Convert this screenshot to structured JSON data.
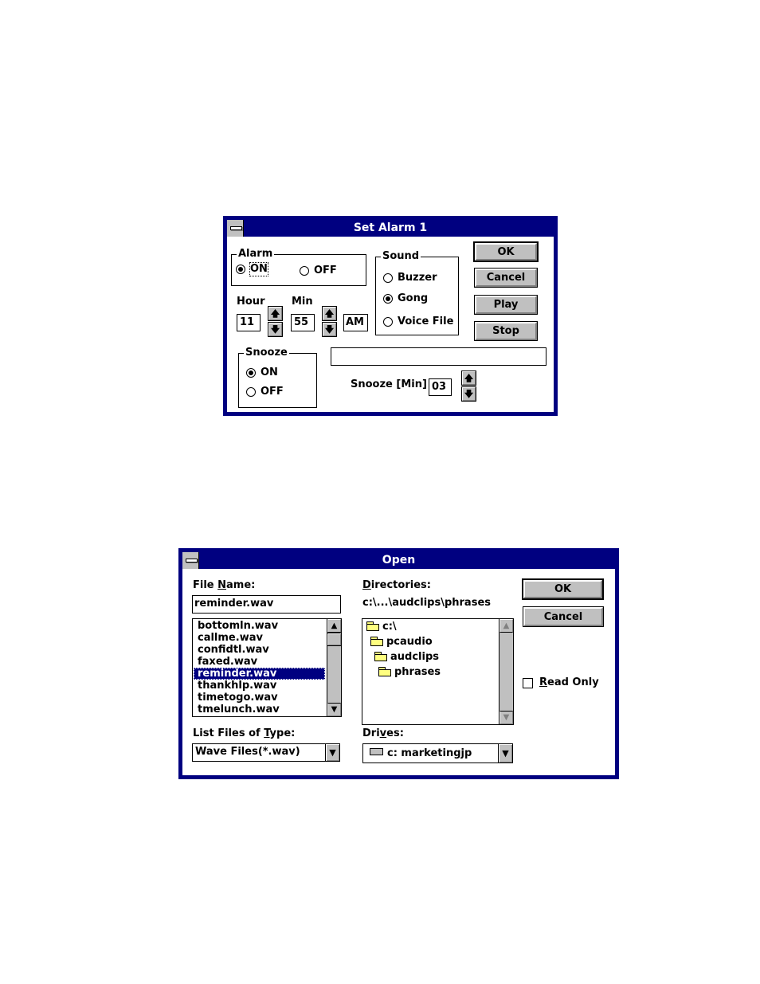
{
  "alarm_dialog": {
    "title": "Set Alarm 1",
    "alarm_group": {
      "label": "Alarm",
      "on_label": "ON",
      "off_label": "OFF",
      "selected": "ON"
    },
    "hour": {
      "label": "Hour",
      "value": "11"
    },
    "min": {
      "label": "Min",
      "value": "55"
    },
    "ampm": "AM",
    "sound_group": {
      "label": "Sound",
      "options": [
        "Buzzer",
        "Gong",
        "Voice File"
      ],
      "selected": "Gong"
    },
    "buttons": {
      "ok": "OK",
      "cancel": "Cancel",
      "play": "Play",
      "stop": "Stop"
    },
    "snooze_group": {
      "label": "Snooze",
      "on_label": "ON",
      "off_label": "OFF",
      "selected": "ON"
    },
    "voice_file_path": "",
    "snooze_min": {
      "label": "Snooze [Min]",
      "value": "03"
    }
  },
  "open_dialog": {
    "title": "Open",
    "file_name": {
      "label_pre": "File ",
      "label_key": "N",
      "label_post": "ame:",
      "value": "reminder.wav"
    },
    "files": [
      "bottomln.wav",
      "callme.wav",
      "confidtl.wav",
      "faxed.wav",
      "reminder.wav",
      "thankhlp.wav",
      "timetogo.wav",
      "tmelunch.wav"
    ],
    "selected_file": "reminder.wav",
    "directories": {
      "label_pre": "",
      "label_key": "D",
      "label_post": "irectories:",
      "current_path": "c:\\...\\audclips\\phrases",
      "items": [
        "c:\\",
        "pcaudio",
        "audclips",
        "phrases"
      ]
    },
    "list_type": {
      "label_pre": "List Files of ",
      "label_key": "T",
      "label_post": "ype:",
      "value": "Wave Files(*.wav)"
    },
    "drives": {
      "label_pre": "Dri",
      "label_key": "v",
      "label_post": "es:",
      "value": "c: marketingjp"
    },
    "buttons": {
      "ok": "OK",
      "cancel": "Cancel"
    },
    "read_only": {
      "label_key": "R",
      "label_post": "ead Only",
      "checked": false
    }
  }
}
